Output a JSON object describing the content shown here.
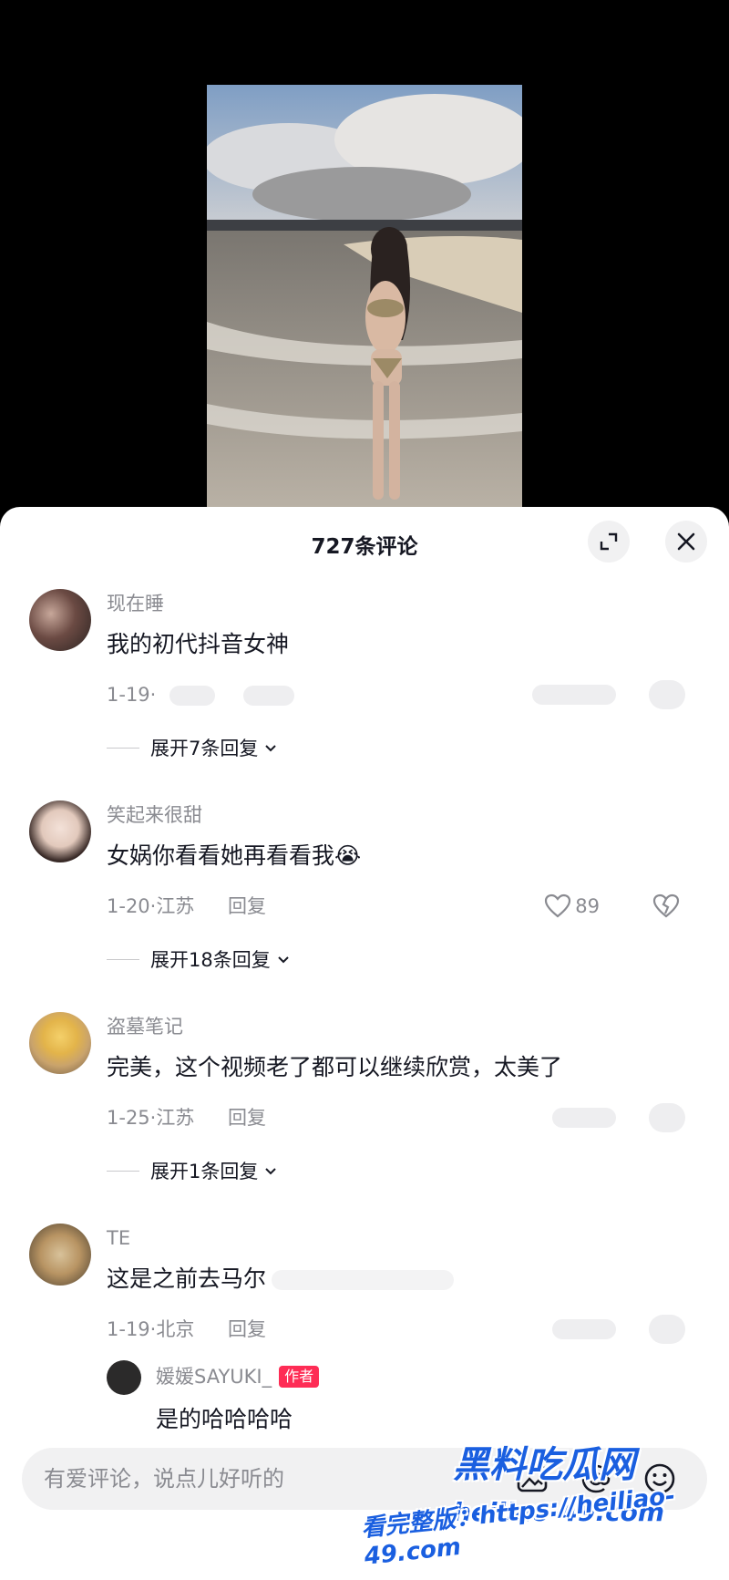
{
  "sheet": {
    "title": "727条评论"
  },
  "comments": [
    {
      "username": "现在睡",
      "text": "我的初代抖音女神",
      "date_location": "1-19·",
      "expand": "展开7条回复"
    },
    {
      "username": "笑起来很甜",
      "text": "女娲你看看她再看看我😭",
      "date_location": "1-20·江苏",
      "reply": "回复",
      "likes": "89",
      "expand": "展开18条回复"
    },
    {
      "username": "盗墓笔记",
      "text": "完美，这个视频老了都可以继续欣赏，太美了",
      "date_location": "1-25·江苏",
      "reply": "回复",
      "expand": "展开1条回复"
    },
    {
      "username": "TE",
      "text": "这是之前去马尔",
      "date_location": "1-19·北京",
      "reply": "回复",
      "sub_reply": {
        "username": "媛媛SAYUKI_",
        "tag": "作者",
        "text": "是的哈哈哈哈"
      }
    }
  ],
  "input": {
    "placeholder": "有爱评论，说点儿好听的"
  },
  "watermark": {
    "line1": "黑料吃瓜网",
    "url": "heiliao-49.com",
    "line2": "看完整版：https://heiliao-49.com"
  },
  "colors": {
    "accent": "#fe2c55",
    "watermark": "#1a5fe0",
    "text": "#161823",
    "muted": "#8a8b91"
  }
}
